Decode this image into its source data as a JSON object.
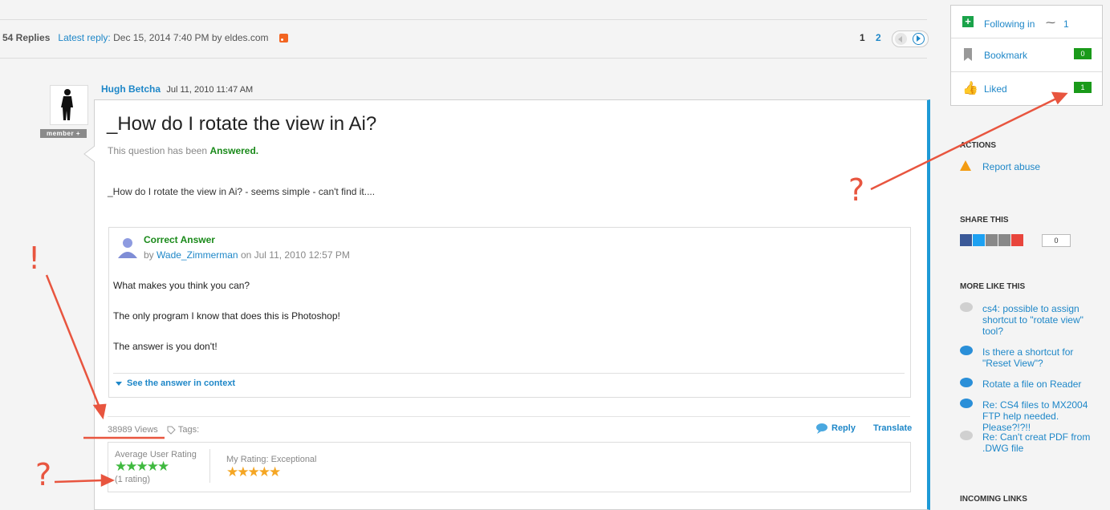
{
  "thread": {
    "replies": "54 Replies",
    "latest_label": "Latest reply:",
    "latest_date": "Dec 15, 2014 7:40 PM by eldes.com",
    "pages": [
      "1",
      "2"
    ]
  },
  "author": {
    "name": "Hugh Betcha",
    "date": "Jul 11, 2010 11:47 AM",
    "badge": "member +"
  },
  "post": {
    "title": "_How do I rotate the view in Ai?",
    "answered_prefix": "This question has been",
    "answered_status": "Answered.",
    "body": "_How do I rotate the view in Ai? - seems simple - can't find it...."
  },
  "answer": {
    "label": "Correct Answer",
    "by_prefix": "by",
    "by_user": "Wade_Zimmerman",
    "by_date": "on Jul 11, 2010 12:57 PM",
    "lines": [
      "What makes you think you can?",
      "The only program I know that does this is Photoshop!",
      "The answer is you don't!"
    ],
    "context_link": "See the answer in context"
  },
  "footer": {
    "views": "38989 Views",
    "tags": "Tags:",
    "reply": "Reply",
    "translate": "Translate"
  },
  "rating": {
    "avg_label": "Average User Rating",
    "avg_count": "(1 rating)",
    "avg_stars": 5,
    "my_label": "My Rating: Exceptional",
    "my_stars": 5
  },
  "sidebar": {
    "following": "Following in",
    "following_count": "1",
    "bookmark": "Bookmark",
    "bookmark_count": "0",
    "liked": "Liked",
    "liked_count": "1",
    "actions_head": "ACTIONS",
    "report": "Report abuse",
    "share_head": "SHARE THIS",
    "share_count": "0",
    "more_head": "MORE LIKE THIS",
    "more_items": [
      "cs4: possible to assign shortcut to \"rotate view\" tool?",
      "Is there a shortcut for \"Reset View\"?",
      "Rotate a file on Reader",
      "Re: CS4 files to MX2004 FTP help needed. Please?!?!!",
      "Re: Can't creat PDF from .DWG file"
    ],
    "incoming_head": "INCOMING LINKS"
  },
  "annotations": {
    "q1": "?",
    "q2": "?",
    "exclaim": "!"
  },
  "colors": {
    "link": "#1e87c8",
    "answered": "#1a8a1a",
    "annotation": "#e8553f",
    "count_badge": "#1a9a1a"
  }
}
